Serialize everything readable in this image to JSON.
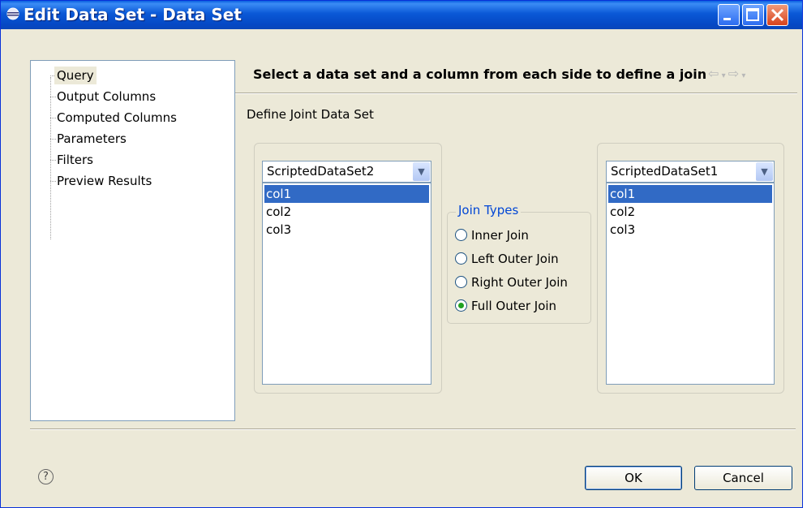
{
  "window": {
    "title": "Edit Data Set - Data Set",
    "controls": [
      "minimize",
      "maximize",
      "close"
    ],
    "title_icon": "eclipse-icon"
  },
  "tree": {
    "items": [
      {
        "label": "Query",
        "selected": true
      },
      {
        "label": "Output Columns",
        "selected": false
      },
      {
        "label": "Computed Columns",
        "selected": false
      },
      {
        "label": "Parameters",
        "selected": false
      },
      {
        "label": "Filters",
        "selected": false
      },
      {
        "label": "Preview Results",
        "selected": false
      }
    ]
  },
  "page": {
    "header": "Select a data set and a column from each side to define a join",
    "nav_icons": [
      "back-arrow-icon",
      "forward-arrow-icon"
    ],
    "define_label": "Define Joint Data Set"
  },
  "left_dataset": {
    "selected": "ScriptedDataSet2",
    "columns": [
      "col1",
      "col2",
      "col3"
    ],
    "selected_column": "col1"
  },
  "right_dataset": {
    "selected": "ScriptedDataSet1",
    "columns": [
      "col1",
      "col2",
      "col3"
    ],
    "selected_column": "col1"
  },
  "join_types": {
    "label": "Join Types",
    "options": [
      {
        "label": "Inner Join",
        "checked": false
      },
      {
        "label": "Left Outer Join",
        "checked": false
      },
      {
        "label": "Right Outer Join",
        "checked": false
      },
      {
        "label": "Full Outer Join",
        "checked": true
      }
    ]
  },
  "footer": {
    "help_icon": "help-icon",
    "ok_label": "OK",
    "cancel_label": "Cancel"
  },
  "colors": {
    "titlebar": "#0a58d6",
    "selection": "#316ac5",
    "groupLabel": "#0046d5",
    "dialog": "#ece9d8"
  }
}
